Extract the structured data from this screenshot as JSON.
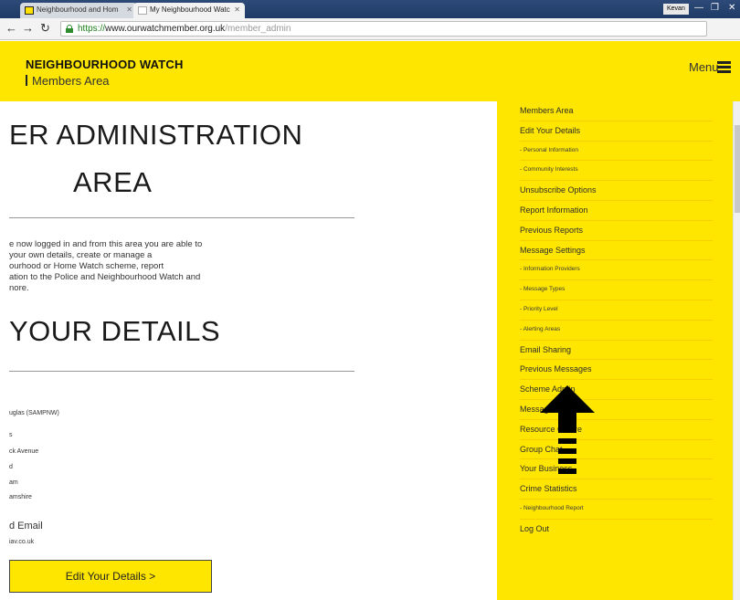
{
  "browser": {
    "tabs": [
      {
        "title": "Neighbourhood and Hom"
      },
      {
        "title": "My Neighbourhood Watc"
      }
    ],
    "user": "Kevan",
    "url": {
      "scheme": "https://",
      "host": "www.ourwatchmember.org.uk",
      "path": "/member_admin"
    }
  },
  "header": {
    "brand": "NEIGHBOURHOOD WATCH",
    "subtitle": "Members Area",
    "menu_label": "Menu"
  },
  "main": {
    "title_line1": "ER ADMINISTRATION",
    "title_line2": "AREA",
    "intro_lines": [
      "e now logged in and from this area you are able to",
      "your own details, create or manage a",
      "ourhood or Home Watch scheme, report",
      "ation to the Police and Neighbourhood Watch and",
      "nore."
    ],
    "details_title": "YOUR DETAILS",
    "details": [
      "uglas (SAMPNW)",
      "s",
      "ck Avenue",
      "d",
      "am",
      "amshire",
      "d Email",
      "iav.co.uk"
    ],
    "edit_button": "Edit Your Details >"
  },
  "sidebar": {
    "items": [
      {
        "label": "Members Area",
        "kind": "main"
      },
      {
        "label": "Edit Your Details",
        "kind": "main"
      },
      {
        "label": "- Personal Information",
        "kind": "sub"
      },
      {
        "label": "- Community Interests",
        "kind": "sub"
      },
      {
        "label": "Unsubscribe Options",
        "kind": "main"
      },
      {
        "label": "Report Information",
        "kind": "main"
      },
      {
        "label": "Previous Reports",
        "kind": "main"
      },
      {
        "label": "Message Settings",
        "kind": "main"
      },
      {
        "label": "- Information Providers",
        "kind": "sub"
      },
      {
        "label": "- Message Types",
        "kind": "sub"
      },
      {
        "label": "- Priority Level",
        "kind": "sub"
      },
      {
        "label": "- Alerting Areas",
        "kind": "sub"
      },
      {
        "label": "Email Sharing",
        "kind": "main"
      },
      {
        "label": "Previous Messages",
        "kind": "main"
      },
      {
        "label": "Scheme Admin",
        "kind": "main"
      },
      {
        "label": "Message Members",
        "kind": "main"
      },
      {
        "label": "Resource Centre",
        "kind": "main"
      },
      {
        "label": "Group Chat",
        "kind": "main"
      },
      {
        "label": "Your Business",
        "kind": "main"
      },
      {
        "label": "Crime Statistics",
        "kind": "main"
      },
      {
        "label": "- Neighbourhood Report",
        "kind": "sub"
      },
      {
        "label": "Log Out",
        "kind": "main"
      }
    ]
  },
  "colors": {
    "brand_yellow": "#ffe600",
    "chrome_blue": "#1f3a66",
    "arrow": "#000000"
  }
}
